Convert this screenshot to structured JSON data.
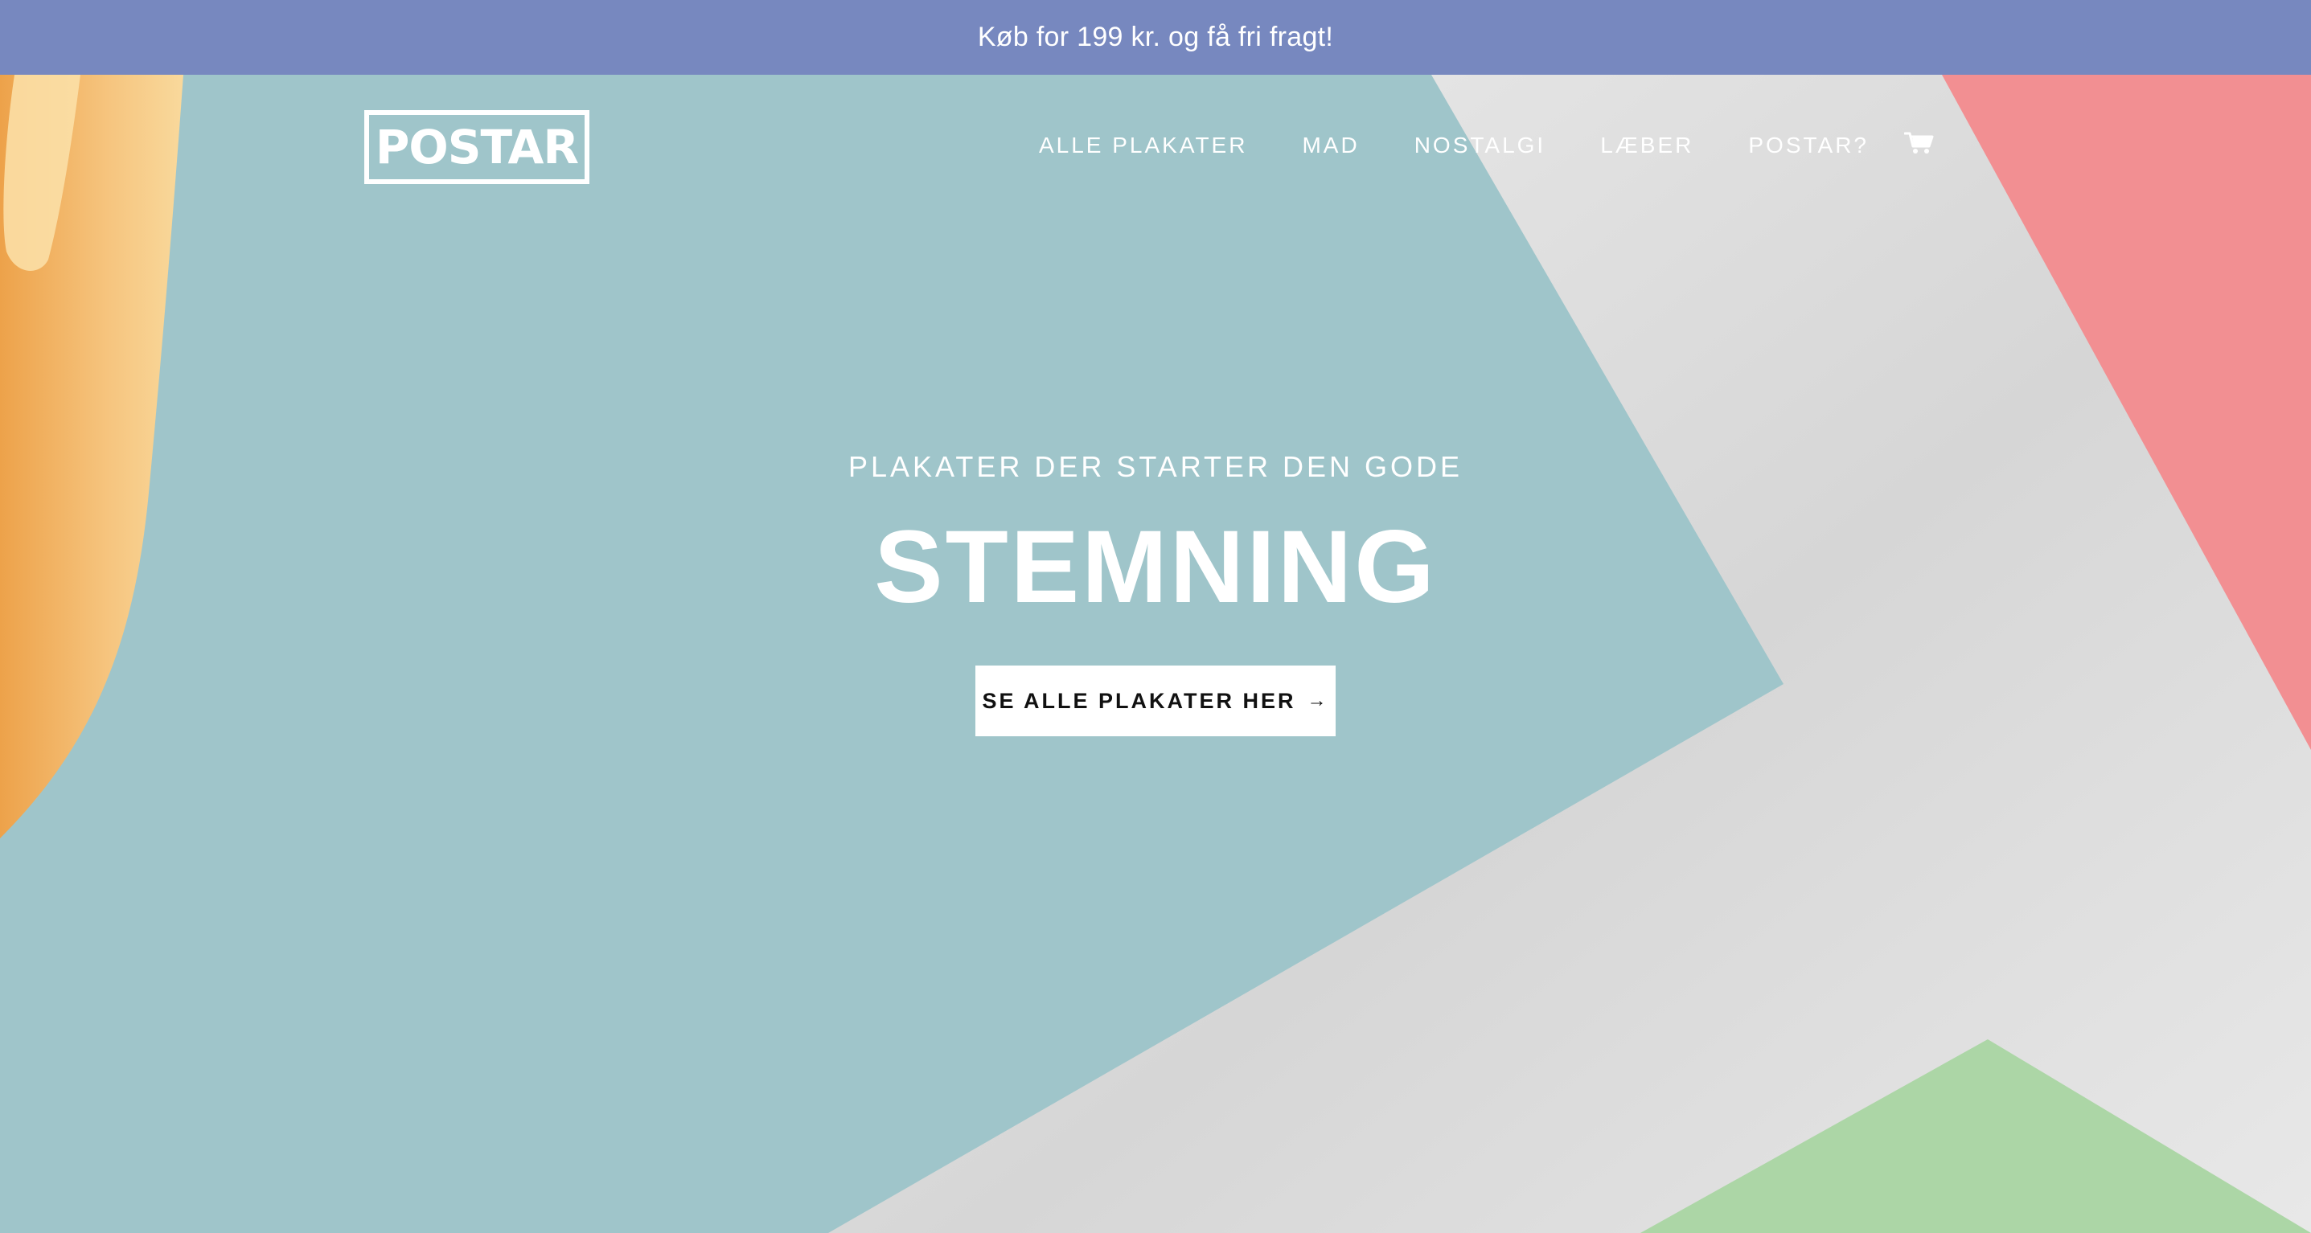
{
  "announcement": {
    "text": "Køb for 199 kr. og få fri fragt!"
  },
  "header": {
    "logo_text": "POSTAR",
    "nav": [
      {
        "label": "ALLE PLAKATER"
      },
      {
        "label": "MAD"
      },
      {
        "label": "NOSTALGI"
      },
      {
        "label": "LÆBER"
      },
      {
        "label": "POSTAR?"
      }
    ],
    "cart_icon": "cart-icon"
  },
  "hero": {
    "subtitle": "PLAKATER DER STARTER DEN GODE",
    "title": "STEMNING",
    "cta_label": "SE ALLE PLAKATER HER",
    "cta_arrow": "→"
  },
  "colors": {
    "announcement_bg": "#7788bf",
    "hero_teal": "#9fc5ca",
    "paper_grey": "#e2e2e2",
    "pink": "#f28f92",
    "green": "#acd6a6",
    "orange": "#f3b86a"
  }
}
